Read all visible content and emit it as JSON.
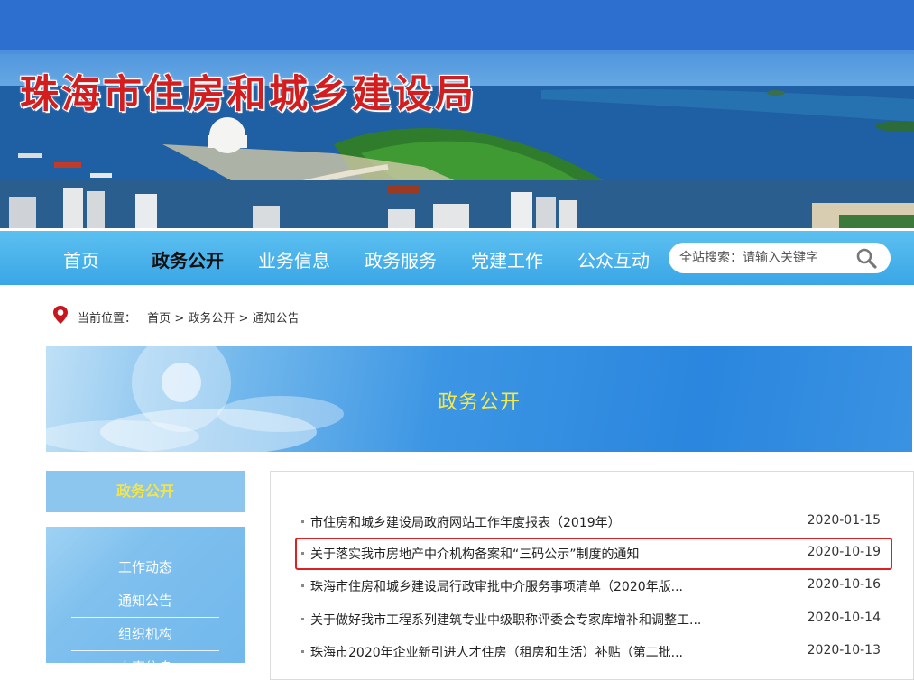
{
  "site": {
    "title": "珠海市住房和城乡建设局"
  },
  "nav": {
    "items": [
      {
        "label": "首页",
        "active": false
      },
      {
        "label": "政务公开",
        "active": true
      },
      {
        "label": "业务信息",
        "active": false
      },
      {
        "label": "政务服务",
        "active": false
      },
      {
        "label": "党建工作",
        "active": false
      },
      {
        "label": "公众互动",
        "active": false
      }
    ],
    "search_placeholder": "全站搜索：请输入关键字"
  },
  "breadcrumb": {
    "prefix": "当前位置：",
    "items": [
      "首页",
      "政务公开",
      "通知公告"
    ],
    "separator": ">"
  },
  "section": {
    "title": "政务公开"
  },
  "sidebar": {
    "heading": "政务公开",
    "items": [
      "工作动态",
      "通知公告",
      "组织机构",
      "人事信息"
    ]
  },
  "list": {
    "items": [
      {
        "title": "市住房和城乡建设局政府网站工作年度报表（2019年）",
        "date": "2020-01-15"
      },
      {
        "title": "关于落实我市房地产中介机构备案和“三码公示”制度的通知",
        "date": "2020-10-19",
        "highlighted": true
      },
      {
        "title": "珠海市住房和城乡建设局行政审批中介服务事项清单（2020年版...",
        "date": "2020-10-16"
      },
      {
        "title": "关于做好我市工程系列建筑专业中级职称评委会专家库增补和调整工...",
        "date": "2020-10-14"
      },
      {
        "title": "珠海市2020年企业新引进人才住房（租房和生活）补贴（第二批...",
        "date": "2020-10-13"
      }
    ]
  },
  "colors": {
    "nav": "#3aa6e6",
    "title_red": "#d21e1e",
    "highlight": "#e02020",
    "heading_yellow": "#f3e44a"
  }
}
